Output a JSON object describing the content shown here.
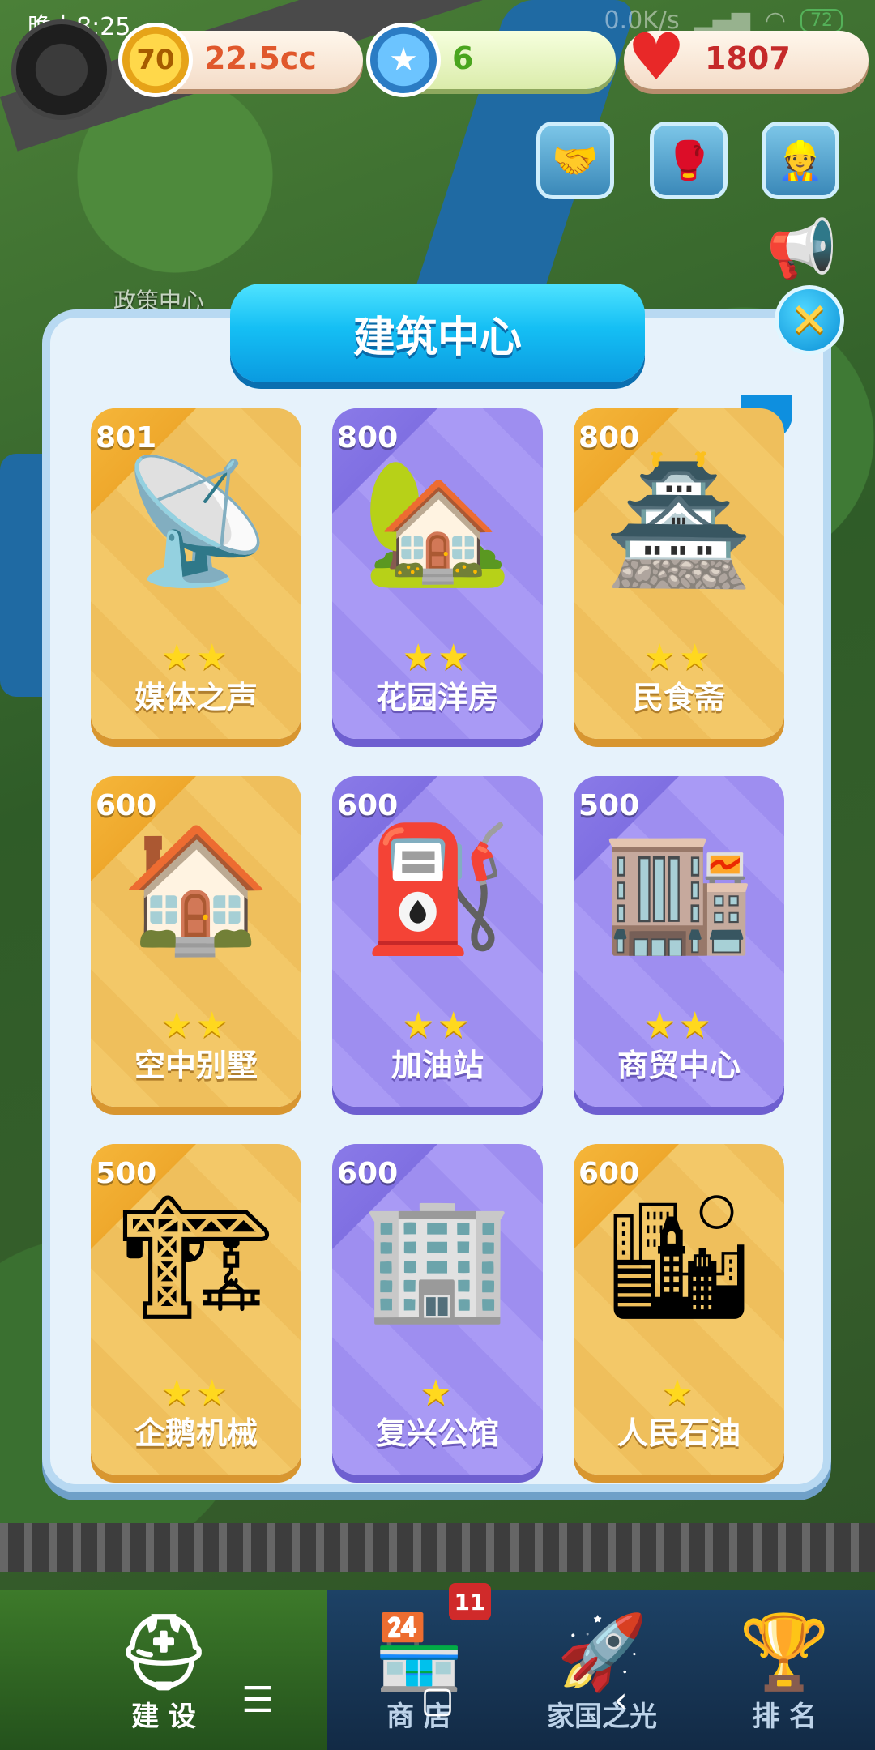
{
  "status_bar": {
    "time": "晚上8:25",
    "net_speed": "0.0K/s",
    "battery": "72"
  },
  "resources": {
    "coins": "22.5cc",
    "coin_icon_text": "70",
    "stars": "6",
    "hearts": "1807"
  },
  "map": {
    "label": "政策中心"
  },
  "panel": {
    "title": "建筑中心",
    "close_label": "✕",
    "buildings": [
      {
        "price": "801",
        "name": "媒体之声",
        "stars": 2,
        "theme": "gold"
      },
      {
        "price": "800",
        "name": "花园洋房",
        "stars": 2,
        "theme": "purple"
      },
      {
        "price": "800",
        "name": "民食斋",
        "stars": 2,
        "theme": "gold"
      },
      {
        "price": "600",
        "name": "空中别墅",
        "stars": 2,
        "theme": "gold"
      },
      {
        "price": "600",
        "name": "加油站",
        "stars": 2,
        "theme": "purple"
      },
      {
        "price": "500",
        "name": "商贸中心",
        "stars": 2,
        "theme": "purple"
      },
      {
        "price": "500",
        "name": "企鹅机械",
        "stars": 2,
        "theme": "gold"
      },
      {
        "price": "600",
        "name": "复兴公馆",
        "stars": 1,
        "theme": "purple"
      },
      {
        "price": "600",
        "name": "人民石油",
        "stars": 1,
        "theme": "gold"
      }
    ]
  },
  "bottom_nav": {
    "items": [
      {
        "label": "建 设"
      },
      {
        "label": "商 店"
      },
      {
        "label": "家国之光"
      },
      {
        "label": "排 名"
      }
    ],
    "shop_badge": "11"
  },
  "colors": {
    "panel_bg": "#e6f2fb",
    "title_blue": "#15bff4",
    "card_gold": "#f3c868",
    "card_purple": "#a99af5"
  }
}
